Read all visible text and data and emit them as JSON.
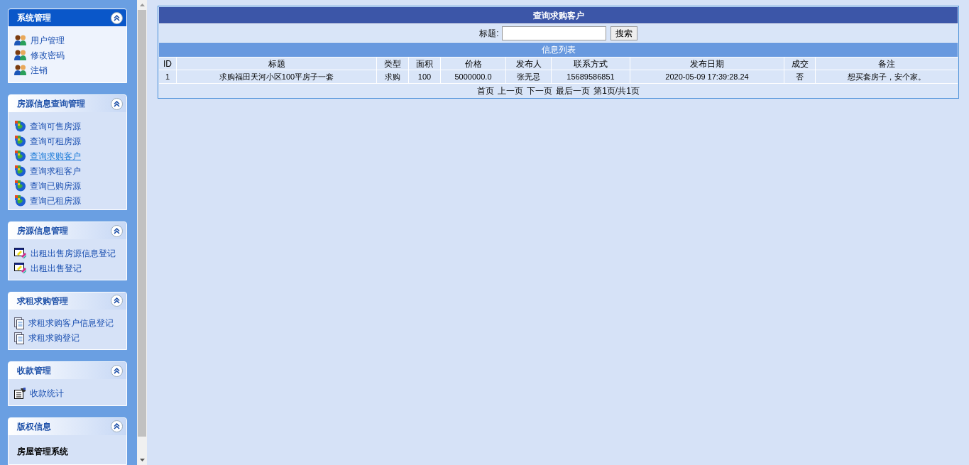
{
  "sidebar": {
    "sections": [
      {
        "title": "系统管理",
        "selected": true,
        "kind": "links",
        "items": [
          {
            "label": "用户管理",
            "kind": "users",
            "selected": false
          },
          {
            "label": "修改密码",
            "kind": "users",
            "selected": false
          },
          {
            "label": "注销",
            "kind": "users",
            "selected": false
          }
        ]
      },
      {
        "title": "房源信息查询管理",
        "selected": false,
        "kind": "links",
        "items": [
          {
            "label": "查询可售房源",
            "kind": "globe",
            "selected": false
          },
          {
            "label": "查询可租房源",
            "kind": "globe",
            "selected": false
          },
          {
            "label": "查询求购客户",
            "kind": "globe",
            "selected": true
          },
          {
            "label": "查询求租客户",
            "kind": "globe",
            "selected": false
          },
          {
            "label": "查询已购房源",
            "kind": "globe",
            "selected": false
          },
          {
            "label": "查询已租房源",
            "kind": "globe",
            "selected": false
          }
        ]
      },
      {
        "title": "房源信息管理",
        "selected": false,
        "kind": "links",
        "items": [
          {
            "label": "出租出售房源信息登记",
            "kind": "edit",
            "selected": false
          },
          {
            "label": "出租出售登记",
            "kind": "edit",
            "selected": false
          }
        ]
      },
      {
        "title": "求租求购管理",
        "selected": false,
        "kind": "links",
        "items": [
          {
            "label": "求租求购客户信息登记",
            "kind": "doc",
            "selected": false
          },
          {
            "label": "求租求购登记",
            "kind": "doc",
            "selected": false
          }
        ]
      },
      {
        "title": "收款管理",
        "selected": false,
        "kind": "links",
        "items": [
          {
            "label": "收款统计",
            "kind": "stats",
            "selected": false
          }
        ]
      },
      {
        "title": "版权信息",
        "selected": false,
        "kind": "text",
        "text": "房屋管理系统"
      }
    ]
  },
  "main": {
    "title": "查询求购客户",
    "search": {
      "label": "标题:",
      "button": "搜索"
    },
    "list_title": "信息列表",
    "table": {
      "columns": [
        "ID",
        "标题",
        "类型",
        "面积",
        "价格",
        "发布人",
        "联系方式",
        "发布日期",
        "成交",
        "备注"
      ],
      "rows": [
        [
          "1",
          "求购福田天河小区100平房子一套",
          "求购",
          "100",
          "5000000.0",
          "张无忌",
          "15689586851",
          "2020-05-09 17:39:28.24",
          "否",
          "想买套房子，安个家。"
        ]
      ]
    },
    "pagination": [
      "首页",
      "上一页",
      "下一页",
      "最后一页",
      "第1页/共1页"
    ]
  }
}
